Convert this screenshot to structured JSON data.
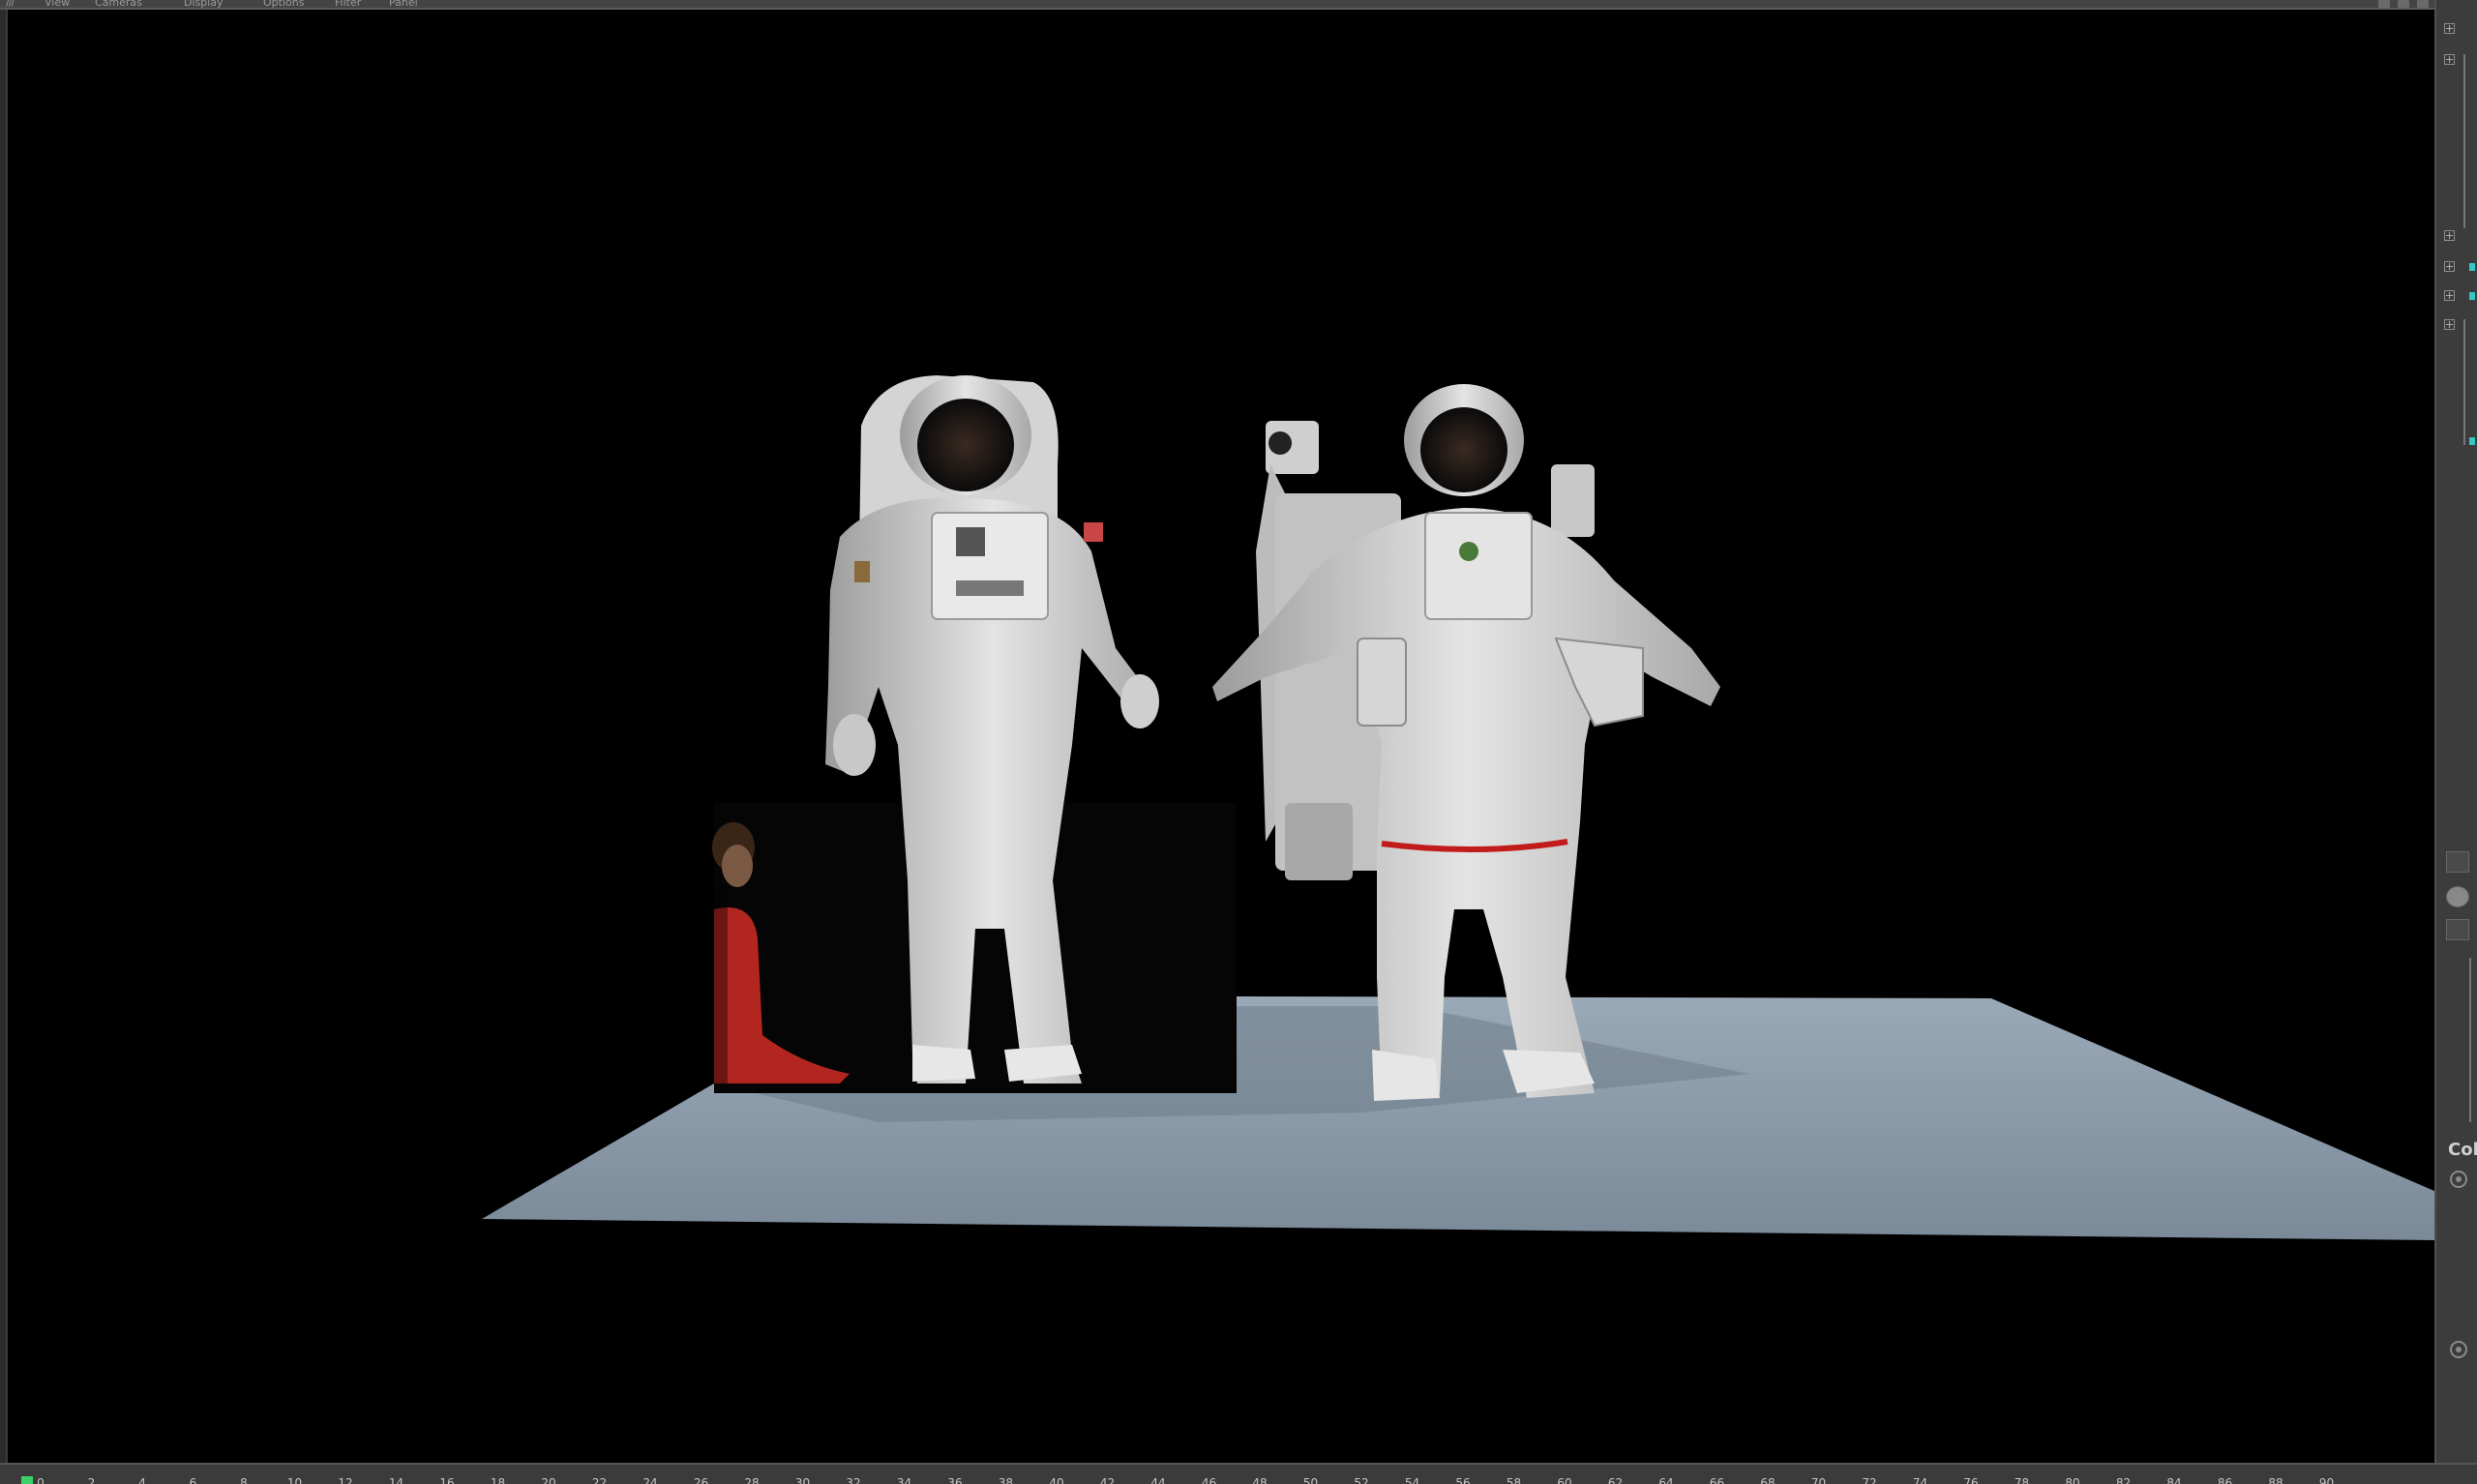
{
  "menubar": {
    "grip": "///",
    "items": [
      "View",
      "Cameras",
      "Display",
      "Options",
      "Filter",
      "Panel"
    ]
  },
  "sidepanel": {
    "col_label": "Col"
  },
  "timeline": {
    "current_frame": "0",
    "ticks": [
      "0",
      "2",
      "4",
      "6",
      "8",
      "10",
      "12",
      "14",
      "16",
      "18",
      "20",
      "22",
      "24",
      "26",
      "28",
      "30",
      "32",
      "34",
      "36",
      "38",
      "40",
      "42",
      "44",
      "46",
      "48",
      "50",
      "52",
      "54",
      "56",
      "58",
      "60",
      "62",
      "64",
      "66",
      "68",
      "70",
      "72",
      "74",
      "76",
      "78",
      "80",
      "82",
      "84",
      "86",
      "88",
      "90"
    ]
  },
  "colors": {
    "viewport_bg": "#000000",
    "floor": "#8796a5",
    "current_frame_marker": "#3ad16a",
    "suit_stripe": "#c21b1b",
    "shirt": "#b2261f"
  }
}
